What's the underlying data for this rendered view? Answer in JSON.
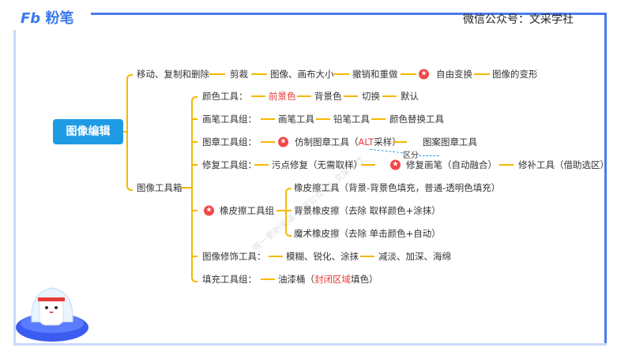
{
  "header": {
    "logo": "粉笔",
    "account": "微信公众号：文采学社"
  },
  "watermark": "唯一更新渠道 微信公众号：文采学社",
  "colors": {
    "frame": "#4a7af0",
    "root": "#1f9be6",
    "branch": "#f5b800",
    "highlight": "#e83a3a"
  },
  "root": "图像编辑",
  "branch1": {
    "label": "移动、复制和删除",
    "items": [
      "剪裁",
      "图像、画布大小",
      "撤销和重做",
      "自由变换",
      "图像的变形"
    ]
  },
  "branch2": {
    "label": "图像工具箱",
    "color": {
      "label": "颜色工具：",
      "items": [
        "前景色",
        "背景色",
        "切换",
        "默认"
      ]
    },
    "brush": {
      "label": "画笔工具组：",
      "items": [
        "画笔工具",
        "铅笔工具",
        "颜色替换工具"
      ]
    },
    "stamp": {
      "label": "图章工具组：",
      "clone_a": "仿制图章工具（",
      "clone_b": "ALT",
      "clone_c": "采样）",
      "pattern": "图案图章工具"
    },
    "distinguish": "区分",
    "heal": {
      "label": "修复工具组：",
      "items": [
        "污点修复（无需取样）",
        "修复画笔（自动融合）",
        "修补工具（借助选区）"
      ]
    },
    "eraser": {
      "label": "橡皮擦工具组",
      "items": [
        "橡皮擦工具（背景-背景色填充，普通-透明色填充）",
        "背景橡皮擦（去除 取样颜色+涂抹）",
        "魔术橡皮擦（去除 单击颜色+自动）"
      ]
    },
    "retouch": {
      "label": "图像修饰工具：",
      "items": [
        "模糊、锐化、涂抹",
        "减淡、加深、海绵"
      ]
    },
    "fill": {
      "label": "填充工具组：",
      "a": "油漆桶（",
      "b": "封闭区域",
      "c": "填色）"
    }
  }
}
